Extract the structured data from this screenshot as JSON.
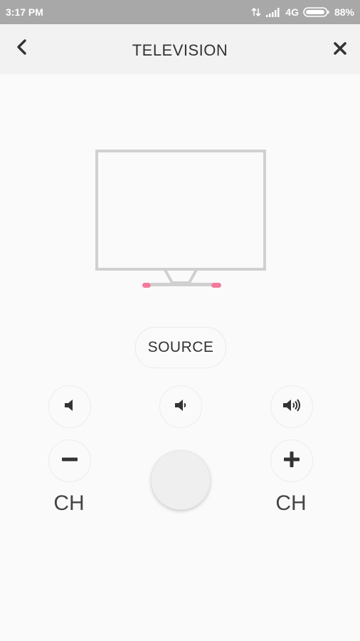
{
  "status_bar": {
    "time": "3:17 PM",
    "network": "4G",
    "battery": "88%",
    "icons": [
      "data-transfer-icon",
      "signal-icon",
      "battery-icon"
    ]
  },
  "app_bar": {
    "title": "TELEVISION",
    "back_icon": "back-chevron-icon",
    "close_icon": "close-icon"
  },
  "illustration": {
    "name": "television-icon",
    "accent_color": "#f27b9b",
    "stroke_color": "#d0d0d0"
  },
  "controls": {
    "source_label": "SOURCE",
    "mute_icon": "volume-mute-icon",
    "volume_down_icon": "volume-down-icon",
    "volume_up_icon": "volume-up-icon",
    "channel_down_icon": "minus-icon",
    "channel_up_icon": "plus-icon",
    "channel_down_label": "CH",
    "channel_up_label": "CH",
    "power_button": "center-button"
  }
}
